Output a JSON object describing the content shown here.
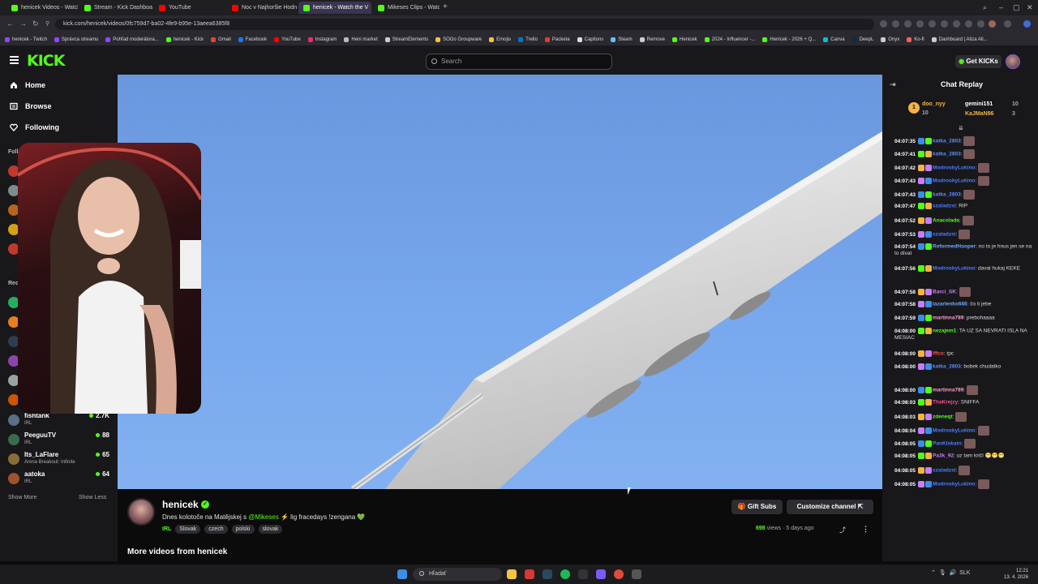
{
  "browser": {
    "tabs": [
      {
        "label": "henicek Videos - Watch Online",
        "color": "#53fc18",
        "active": false
      },
      {
        "label": "Stream - Kick Dashboard",
        "color": "#53fc18",
        "active": false
      },
      {
        "label": "YouTube",
        "color": "#ff0000",
        "active": false
      },
      {
        "label": "Noc v Najhoršie Hodnotenej",
        "color": "#ff0000",
        "active": false
      },
      {
        "label": "henicek - Watch the V",
        "color": "#53fc18",
        "active": true
      },
      {
        "label": "Mikeses Clips - Watch Live",
        "color": "#53fc18",
        "active": false
      }
    ],
    "url": "kick.com/henicek/videos/0fc759d7-ba02-4fe9-b95e-13aeea6385f8",
    "bookmarks": [
      {
        "label": "henicek - Twitch",
        "color": "#9146ff"
      },
      {
        "label": "Správca streamu",
        "color": "#9146ff"
      },
      {
        "label": "Pohľad moderátora...",
        "color": "#9146ff"
      },
      {
        "label": "henicek - Kick",
        "color": "#53fc18"
      },
      {
        "label": "Gmail",
        "color": "#ea4335"
      },
      {
        "label": "Facebook",
        "color": "#1877f2"
      },
      {
        "label": "YouTube",
        "color": "#ff0000"
      },
      {
        "label": "Instagram",
        "color": "#e1306c"
      },
      {
        "label": "Heni market",
        "color": "#bbbbbb"
      },
      {
        "label": "StreamElements",
        "color": "#cccccc"
      },
      {
        "label": "SOGo Groupware",
        "color": "#f5c242"
      },
      {
        "label": "Emojis",
        "color": "#f5c242"
      },
      {
        "label": "Trello",
        "color": "#0079bf"
      },
      {
        "label": "Packeta",
        "color": "#e53935"
      },
      {
        "label": "Captions",
        "color": "#dddddd"
      },
      {
        "label": "Steam",
        "color": "#66c0f4"
      },
      {
        "label": "Remove",
        "color": "#cccccc"
      },
      {
        "label": "Henicek",
        "color": "#53fc18"
      },
      {
        "label": "2024 - Influencer -...",
        "color": "#53fc18"
      },
      {
        "label": "Henicek - 2026 + Q...",
        "color": "#53fc18"
      },
      {
        "label": "Canva",
        "color": "#00c4cc"
      },
      {
        "label": "DeepL",
        "color": "#0f2b46"
      },
      {
        "label": "Onyx",
        "color": "#cccccc"
      },
      {
        "label": "Ko-fi",
        "color": "#ff5e5b"
      },
      {
        "label": "Dashboard | Aliza All...",
        "color": "#cccccc"
      }
    ]
  },
  "kick": {
    "logo": "KICK",
    "search_placeholder": "Search",
    "get_kicks": "Get KICKs",
    "nav": [
      {
        "label": "Home",
        "icon": "home-icon"
      },
      {
        "label": "Browse",
        "icon": "browse-icon"
      },
      {
        "label": "Following",
        "icon": "heart-icon"
      }
    ],
    "following_header": "Follo",
    "recommended_header": "Rec",
    "channels": [
      {
        "name": "fishtank",
        "category": "IRL",
        "viewers": "2.7K",
        "color": "#5a6e8a"
      },
      {
        "name": "PeeguuTV",
        "category": "IRL",
        "viewers": "88",
        "color": "#3a6b4e"
      },
      {
        "name": "Its_LaFlare",
        "category": "Arena Breakout: Infinite",
        "viewers": "65",
        "color": "#8a6b3a"
      },
      {
        "name": "aatoka",
        "category": "IRL",
        "viewers": "64",
        "color": "#a0522d"
      }
    ],
    "show_more": "Show More",
    "show_less": "Show Less"
  },
  "video": {
    "channel": "henicek",
    "title_before": "Dnes kolotoče na Matějskej s ",
    "title_link": "@Mikeses",
    "title_after": " ⚡ lig fracedays !zengana 💚",
    "category": "IRL",
    "tags": [
      "Slovak",
      "czech",
      "polski",
      "slovak"
    ],
    "views_count": "698",
    "views_suffix": " views · 5 days ago",
    "gift_subs": "Gift Subs",
    "customize": "Customize channel ⇱",
    "more_videos": "More videos from henicek"
  },
  "chat": {
    "title": "Chat Replay",
    "pinned": [
      {
        "name": "doo_nyy",
        "count": "10",
        "color": "#f5b342"
      },
      {
        "name": "gemini151",
        "count": "10",
        "color": "#ffffff"
      },
      {
        "name": "KaJMaN96",
        "count": "3",
        "color": "#f5b342"
      }
    ],
    "messages": [
      {
        "ts": "04:07:35",
        "user": "katka_2803",
        "color": "#5b8cff",
        "text": "",
        "emote": true
      },
      {
        "ts": "04:07:41",
        "user": "katka_2803",
        "color": "#5b8cff",
        "text": "",
        "emote": true
      },
      {
        "ts": "04:07:42",
        "user": "ModrookyLukino",
        "color": "#4a7dff",
        "text": "",
        "emote": true
      },
      {
        "ts": "04:07:43",
        "user": "ModrookyLukino",
        "color": "#4a7dff",
        "text": "",
        "emote": true
      },
      {
        "ts": "04:07:43",
        "user": "katka_2803",
        "color": "#5b8cff",
        "text": "",
        "emote": true
      },
      {
        "ts": "04:07:47",
        "user": "szaladzsi",
        "color": "#4a7dff",
        "text": "RIP",
        "emote": false
      },
      {
        "ts": "04:07:52",
        "user": "Anacolada",
        "color": "#53fc18",
        "text": "",
        "emote": true
      },
      {
        "ts": "04:07:53",
        "user": "szaladzsi",
        "color": "#4a7dff",
        "text": "",
        "emote": true
      },
      {
        "ts": "04:07:54",
        "user": "ReformedHooper",
        "color": "#6fa8ff",
        "text": "no to je hnus jen se na to dívat",
        "emote": false
      },
      {
        "ts": "04:07:56",
        "user": "ModrookyLukino",
        "color": "#4a7dff",
        "text": "daval hukaj KEKE",
        "emote": false
      },
      {
        "ts": "04:07:58",
        "user": "Barci_SK",
        "color": "#c77dff",
        "text": "",
        "emote": true
      },
      {
        "ts": "04:07:58",
        "user": "lazarlenko666",
        "color": "#6fa8ff",
        "text": "čo ti jebe",
        "emote": false
      },
      {
        "ts": "04:07:59",
        "user": "martinna789",
        "color": "#ff9ecd",
        "text": "prebohaaaa",
        "emote": false
      },
      {
        "ts": "04:08:00",
        "user": "nezajem1",
        "color": "#53fc18",
        "text": "TA UZ SA NEVRATI ISLA NA MESIAC",
        "emote": false
      },
      {
        "ts": "04:08:00",
        "user": "Iffco",
        "color": "#ff4d4d",
        "text": "tpc",
        "emote": false
      },
      {
        "ts": "04:08:00",
        "user": "katka_2803",
        "color": "#5b8cff",
        "text": "bobek chudatko",
        "emote": false
      },
      {
        "ts": "04:08:00",
        "user": "martinna789",
        "color": "#ff9ecd",
        "text": "",
        "emote": true
      },
      {
        "ts": "04:08:03",
        "user": "ThaKrejzy",
        "color": "#ff4d8d",
        "text": "SNIFFA",
        "emote": false
      },
      {
        "ts": "04:08:03",
        "user": "zdeneqt",
        "color": "#53fc18",
        "text": "",
        "emote": true
      },
      {
        "ts": "04:08:04",
        "user": "ModrookyLukino",
        "color": "#4a7dff",
        "text": "",
        "emote": true
      },
      {
        "ts": "04:08:05",
        "user": "PanKlokain",
        "color": "#4a7dff",
        "text": "",
        "emote": true
      },
      {
        "ts": "04:08:05",
        "user": "Pa3k_92",
        "color": "#c77dff",
        "text": "uz tam kričí 😁😁😁",
        "emote": false
      },
      {
        "ts": "04:08:05",
        "user": "szaladzsi",
        "color": "#4a7dff",
        "text": "",
        "emote": true
      },
      {
        "ts": "04:08:05",
        "user": "ModrookyLukino",
        "color": "#4a7dff",
        "text": "",
        "emote": true
      }
    ]
  },
  "taskbar": {
    "search": "Hľadať",
    "lang": "SLK",
    "time": "12:21",
    "date": "13. 4. 2026"
  }
}
